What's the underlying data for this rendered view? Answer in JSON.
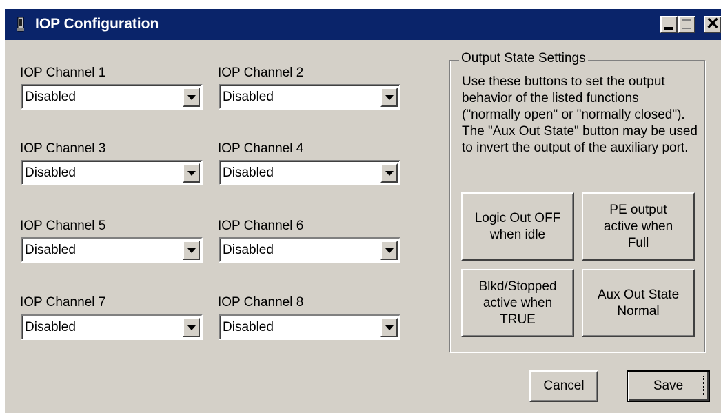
{
  "window": {
    "title": "IOP Configuration",
    "controls": {
      "minimize": "minimize-icon",
      "maximize": "maximize-icon",
      "close_glyph": "✕"
    }
  },
  "channels": [
    {
      "label": "IOP Channel 1",
      "value": "Disabled"
    },
    {
      "label": "IOP Channel 2",
      "value": "Disabled"
    },
    {
      "label": "IOP Channel 3",
      "value": "Disabled"
    },
    {
      "label": "IOP Channel 4",
      "value": "Disabled"
    },
    {
      "label": "IOP Channel 5",
      "value": "Disabled"
    },
    {
      "label": "IOP Channel 6",
      "value": "Disabled"
    },
    {
      "label": "IOP Channel 7",
      "value": "Disabled"
    },
    {
      "label": "IOP Channel 8",
      "value": "Disabled"
    }
  ],
  "output_state": {
    "title": "Output State Settings",
    "description": "Use these buttons to set the output behavior of the listed functions (\"normally open\" or \"normally closed\"). The \"Aux Out State\" button may be used to invert the output of the auxiliary port.",
    "buttons": {
      "logic_out": [
        "Logic Out OFF",
        "when idle"
      ],
      "pe_output": [
        "PE output",
        "active when",
        "Full"
      ],
      "blkd_stopped": [
        "Blkd/Stopped",
        "active when",
        "TRUE"
      ],
      "aux_out": [
        "Aux Out State",
        "Normal"
      ]
    }
  },
  "footer": {
    "cancel_label": "Cancel",
    "save_label": "Save"
  },
  "colors": {
    "titlebar": "#0a246a",
    "face": "#d4d0c8"
  }
}
